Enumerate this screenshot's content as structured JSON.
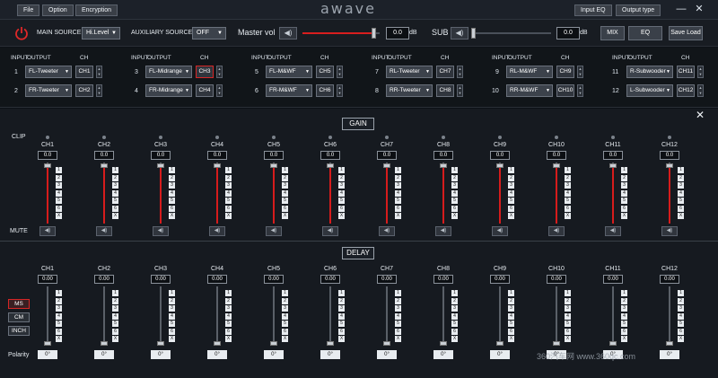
{
  "menu": {
    "file": "File",
    "option": "Option",
    "encryption": "Encryption",
    "input_eq": "Input EQ",
    "output_type": "Output type"
  },
  "brand": "awave",
  "window": {
    "minimize": "—",
    "close": "✕"
  },
  "source": {
    "main_label": "MAIN SOURCE",
    "main_value": "Hi.Level",
    "aux_label": "AUXILIARY SOURCE",
    "aux_value": "OFF",
    "master_label": "Master vol",
    "master_value": "0.0",
    "master_level": 0.93,
    "sub_label": "SUB",
    "sub_value": "0.0",
    "sub_level": 0.0,
    "db": "dB",
    "mix": "MIX",
    "eq": "EQ",
    "save_load": "Save Load"
  },
  "routing": {
    "headers": {
      "input": "INPUT",
      "output": "OUTPUT",
      "ch": "CH"
    },
    "rows": [
      {
        "n": "1",
        "output": "FL-Tweeter",
        "ch": "CH1"
      },
      {
        "n": "2",
        "output": "FR-Tweeter",
        "ch": "CH2"
      },
      {
        "n": "3",
        "output": "FL-Midrange",
        "ch": "CH3",
        "selected": true
      },
      {
        "n": "4",
        "output": "FR-Midrange",
        "ch": "CH4"
      },
      {
        "n": "5",
        "output": "FL-M&WF",
        "ch": "CH5"
      },
      {
        "n": "6",
        "output": "FR-M&WF",
        "ch": "CH6"
      },
      {
        "n": "7",
        "output": "RL-Tweeter",
        "ch": "CH7"
      },
      {
        "n": "8",
        "output": "RR-Tweeter",
        "ch": "CH8"
      },
      {
        "n": "9",
        "output": "RL-M&WF",
        "ch": "CH9"
      },
      {
        "n": "10",
        "output": "RR-M&WF",
        "ch": "CH10"
      },
      {
        "n": "11",
        "output": "R-Subwooder",
        "ch": "CH11"
      },
      {
        "n": "12",
        "output": "L-Subwooder",
        "ch": "CH12"
      }
    ]
  },
  "gain": {
    "title": "GAIN",
    "clip_label": "CLIP",
    "mute_label": "MUTE",
    "steps": [
      "1",
      "2",
      "3",
      "4",
      "5",
      "6",
      "X"
    ],
    "channels": [
      {
        "ch": "CH1",
        "value": "0.0",
        "level": 0.94
      },
      {
        "ch": "CH2",
        "value": "0.0",
        "level": 0.94
      },
      {
        "ch": "CH3",
        "value": "0.0",
        "level": 0.94
      },
      {
        "ch": "CH4",
        "value": "0.0",
        "level": 0.94
      },
      {
        "ch": "CH5",
        "value": "0.0",
        "level": 0.94
      },
      {
        "ch": "CH6",
        "value": "0.0",
        "level": 0.94
      },
      {
        "ch": "CH7",
        "value": "0.0",
        "level": 0.94
      },
      {
        "ch": "CH8",
        "value": "0.0",
        "level": 0.94
      },
      {
        "ch": "CH9",
        "value": "0.0",
        "level": 0.94
      },
      {
        "ch": "CH10",
        "value": "0.0",
        "level": 0.94
      },
      {
        "ch": "CH11",
        "value": "0.0",
        "level": 0.94
      },
      {
        "ch": "CH12",
        "value": "0.0",
        "level": 0.94
      }
    ]
  },
  "delay": {
    "title": "DELAY",
    "polarity_label": "Polarity",
    "units": [
      {
        "label": "MS",
        "active": true
      },
      {
        "label": "CM",
        "active": false
      },
      {
        "label": "INCH",
        "active": false
      }
    ],
    "steps": [
      "1",
      "2",
      "3",
      "4",
      "5",
      "6",
      "X"
    ],
    "channels": [
      {
        "ch": "CH1",
        "value": "0.00",
        "polarity": "0°",
        "level": 0.0
      },
      {
        "ch": "CH2",
        "value": "0.00",
        "polarity": "0°",
        "level": 0.0
      },
      {
        "ch": "CH3",
        "value": "0.00",
        "polarity": "0°",
        "level": 0.0
      },
      {
        "ch": "CH4",
        "value": "0.00",
        "polarity": "0°",
        "level": 0.0
      },
      {
        "ch": "CH5",
        "value": "0.00",
        "polarity": "0°",
        "level": 0.0
      },
      {
        "ch": "CH6",
        "value": "0.00",
        "polarity": "0°",
        "level": 0.0
      },
      {
        "ch": "CH7",
        "value": "0.00",
        "polarity": "0°",
        "level": 0.0
      },
      {
        "ch": "CH8",
        "value": "0.00",
        "polarity": "0°",
        "level": 0.0
      },
      {
        "ch": "CH9",
        "value": "0.00",
        "polarity": "0°",
        "level": 0.0
      },
      {
        "ch": "CH10",
        "value": "0.00",
        "polarity": "0°",
        "level": 0.0
      },
      {
        "ch": "CH11",
        "value": "0.00",
        "polarity": "0°",
        "level": 0.0
      },
      {
        "ch": "CH12",
        "value": "0.00",
        "polarity": "0°",
        "level": 0.0
      }
    ]
  },
  "icons": {
    "speaker": "speaker-icon",
    "power": "power-icon",
    "lock": "lock-icon"
  },
  "colors": {
    "accent": "#d81e1e",
    "background": "#161a20",
    "panel": "#111519"
  },
  "watermark": "360汽车网 www.360qc.com"
}
